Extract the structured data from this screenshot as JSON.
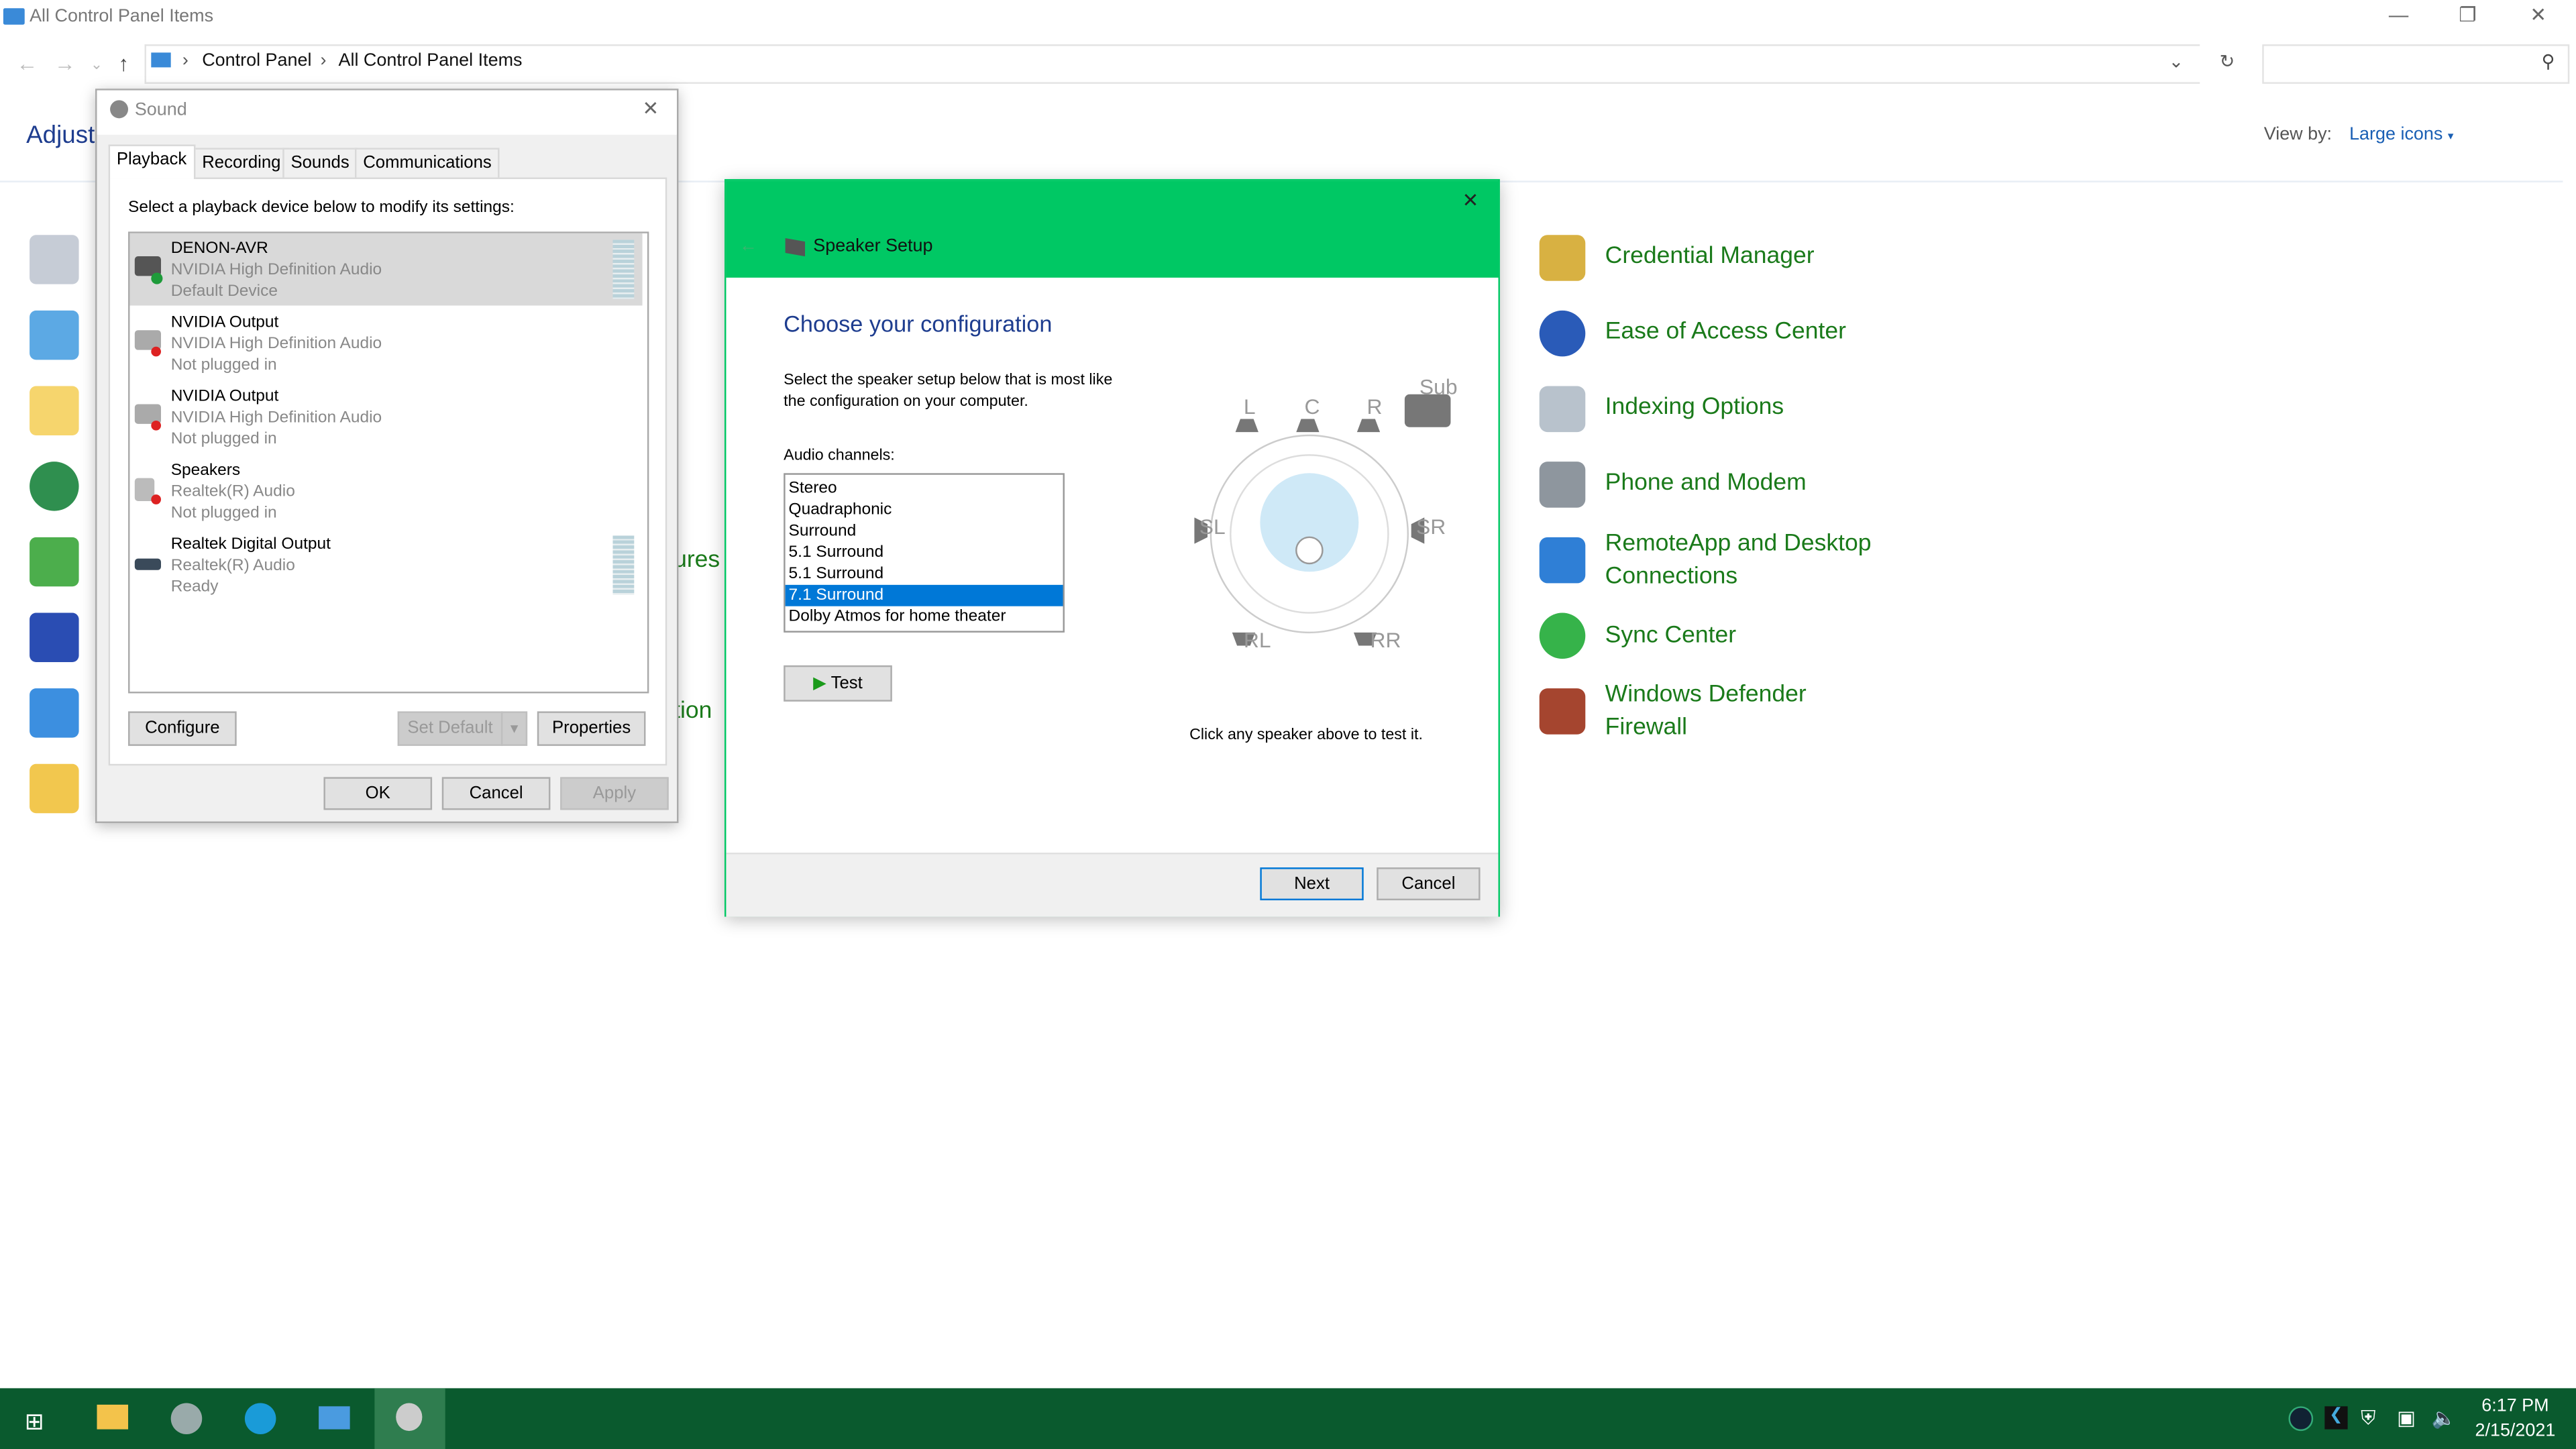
{
  "explorer": {
    "title": "All Control Panel Items",
    "breadcrumb": [
      "Control Panel",
      "All Control Panel Items"
    ],
    "heading_partial": "Adjust",
    "view_by_label": "View by:",
    "view_by_value": "Large icons",
    "hidden_item_fragments": [
      "ures",
      "tion"
    ],
    "items": [
      {
        "label": "Credential Manager",
        "icon": "credential-manager-icon"
      },
      {
        "label": "Ease of Access Center",
        "icon": "ease-of-access-icon"
      },
      {
        "label": "Indexing Options",
        "icon": "indexing-options-icon"
      },
      {
        "label": "Phone and Modem",
        "icon": "phone-modem-icon"
      },
      {
        "label": "RemoteApp and Desktop Connections",
        "line1": "RemoteApp and Desktop",
        "line2": "Connections",
        "icon": "remoteapp-icon"
      },
      {
        "label": "Sync Center",
        "icon": "sync-center-icon"
      },
      {
        "label": "Windows Defender Firewall",
        "line1": "Windows Defender",
        "line2": "Firewall",
        "icon": "firewall-icon"
      }
    ]
  },
  "sound_dialog": {
    "title": "Sound",
    "tabs": [
      "Playback",
      "Recording",
      "Sounds",
      "Communications"
    ],
    "active_tab": "Playback",
    "instruction": "Select a playback device below to modify its settings:",
    "devices": [
      {
        "name": "DENON-AVR",
        "driver": "NVIDIA High Definition Audio",
        "status": "Default Device",
        "selected": true
      },
      {
        "name": "NVIDIA Output",
        "driver": "NVIDIA High Definition Audio",
        "status": "Not plugged in"
      },
      {
        "name": "NVIDIA Output",
        "driver": "NVIDIA High Definition Audio",
        "status": "Not plugged in"
      },
      {
        "name": "Speakers",
        "driver": "Realtek(R) Audio",
        "status": "Not plugged in"
      },
      {
        "name": "Realtek Digital Output",
        "driver": "Realtek(R) Audio",
        "status": "Ready"
      }
    ],
    "configure": "Configure",
    "set_default": "Set Default",
    "properties": "Properties",
    "ok": "OK",
    "cancel": "Cancel",
    "apply": "Apply"
  },
  "speaker_setup": {
    "title": "Speaker Setup",
    "heading": "Choose your configuration",
    "description_line1": "Select the speaker setup below that is most like",
    "description_line2": "the configuration on your computer.",
    "channels_label": "Audio channels:",
    "channels": [
      "Stereo",
      "Quadraphonic",
      "Surround",
      "5.1 Surround",
      "5.1 Surround",
      "7.1 Surround",
      "Dolby Atmos for home theater"
    ],
    "selected_channel": "7.1 Surround",
    "test": "Test",
    "speaker_labels": {
      "l": "L",
      "c": "C",
      "r": "R",
      "sub": "Sub",
      "sl": "SL",
      "sr": "SR",
      "rl": "RL",
      "rr": "RR"
    },
    "hint": "Click any speaker above to test it.",
    "next": "Next",
    "cancel": "Cancel",
    "header_color": "#00c864"
  },
  "taskbar": {
    "color": "#0a5a2e",
    "time": "6:17 PM",
    "date": "2/15/2021"
  }
}
